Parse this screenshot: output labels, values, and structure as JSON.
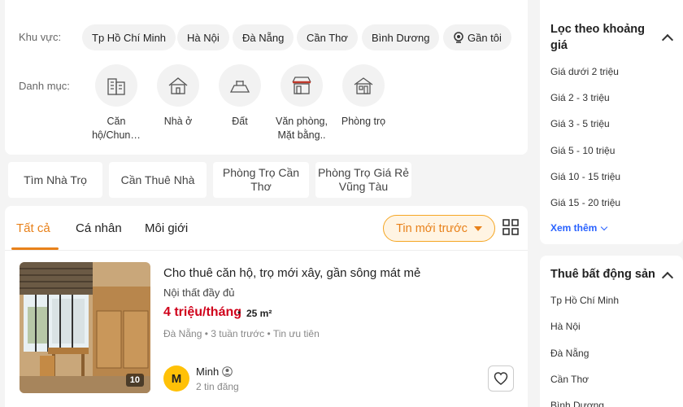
{
  "filters": {
    "area_label": "Khu vực:",
    "areas": [
      "Tp Hồ Chí Minh",
      "Hà Nội",
      "Đà Nẵng",
      "Cần Thơ",
      "Bình Dương"
    ],
    "near_me": "Gần tôi",
    "category_label": "Danh mục:",
    "categories": [
      {
        "label": "Căn hộ/Chun…",
        "icon": "apartment-icon"
      },
      {
        "label": "Nhà ở",
        "icon": "house-icon"
      },
      {
        "label": "Đất",
        "icon": "land-icon"
      },
      {
        "label": "Văn phòng, Mặt bằng..",
        "icon": "storefront-icon"
      },
      {
        "label": "Phòng trọ",
        "icon": "room-icon"
      }
    ]
  },
  "quick_tags": [
    "Tìm Nhà Trọ",
    "Cần Thuê Nhà",
    "Phòng Trọ Cần Thơ",
    "Phòng Trọ Giá Rẻ Vũng Tàu"
  ],
  "tabs": [
    "Tất cả",
    "Cá nhân",
    "Môi giới"
  ],
  "sort": {
    "label": "Tin mới trước"
  },
  "listing": {
    "title": "Cho thuê căn hộ, trọ mới xây, gần sông mát mẻ",
    "subtitle": "Nội thất đầy đủ",
    "price": "4 triệu/tháng",
    "separator": "•",
    "area": "25 m²",
    "meta": "Đà Nẵng • 3 tuần trước • Tin ưu tiên",
    "photo_count": "10",
    "seller": {
      "initial": "M",
      "name": "Minh",
      "posts": "2 tin đăng"
    }
  },
  "price_filter": {
    "title": "Lọc theo khoảng giá",
    "items": [
      "Giá dưới 2 triệu",
      "Giá 2 - 3 triệu",
      "Giá 3 - 5 triệu",
      "Giá 5 - 10 triệu",
      "Giá 10 - 15 triệu",
      "Giá 15 - 20 triệu"
    ],
    "see_more": "Xem thêm"
  },
  "rent_section": {
    "title": "Thuê bất động sản",
    "items": [
      "Tp Hồ Chí Minh",
      "Hà Nội",
      "Đà Nẵng",
      "Cần Thơ",
      "Bình Dương"
    ]
  },
  "colors": {
    "accent": "#e8811a",
    "price": "#d0021b",
    "link": "#2962ff",
    "avatar": "#ffc107"
  }
}
